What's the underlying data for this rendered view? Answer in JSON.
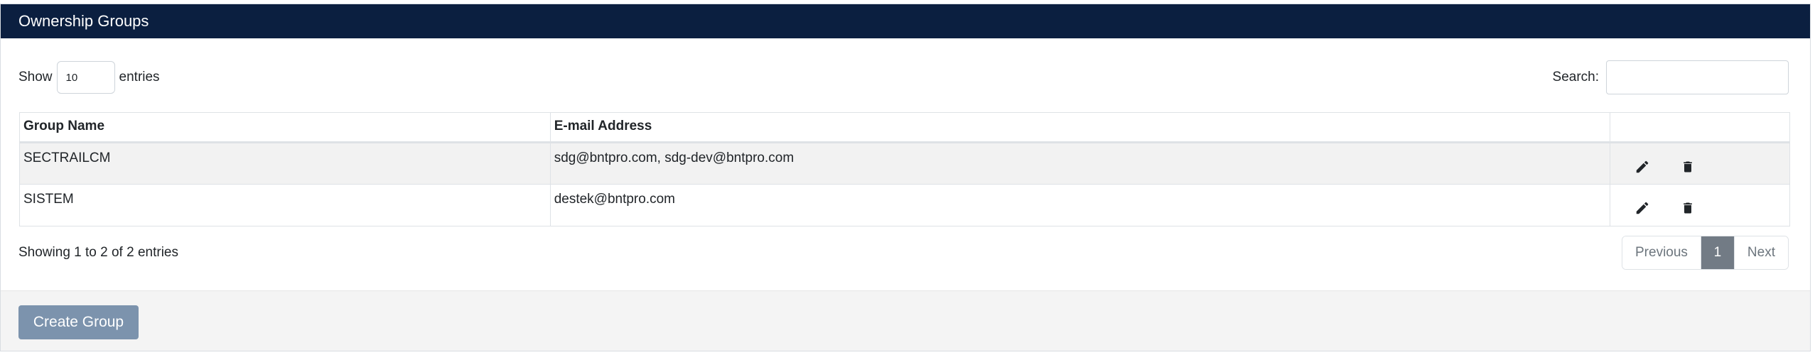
{
  "panel": {
    "title": "Ownership Groups"
  },
  "controls": {
    "show_label": "Show",
    "entries_value": "10",
    "entries_label": "entries",
    "search_label": "Search:",
    "search_value": ""
  },
  "table": {
    "headers": {
      "name": "Group Name",
      "email": "E-mail Address",
      "actions": ""
    },
    "rows": [
      {
        "name": "SECTRAILCM",
        "email": "sdg@bntpro.com, sdg-dev@bntpro.com",
        "edit_icon": "pencil-icon",
        "delete_icon": "trash-icon"
      },
      {
        "name": "SISTEM",
        "email": "destek@bntpro.com",
        "edit_icon": "pencil-icon",
        "delete_icon": "trash-icon"
      }
    ]
  },
  "info": {
    "text": "Showing 1 to 2 of 2 entries"
  },
  "pagination": {
    "previous": "Previous",
    "current": "1",
    "next": "Next"
  },
  "footer": {
    "create_label": "Create Group"
  },
  "colors": {
    "header_bg": "#0b1f40",
    "button_bg": "#7c93ad",
    "active_page": "#727b85"
  }
}
